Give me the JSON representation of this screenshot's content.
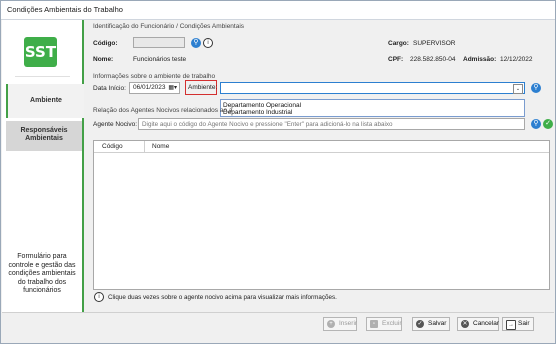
{
  "window": {
    "title": "Condições Ambientais do Trabalho"
  },
  "sidebar": {
    "logo_text": "SST",
    "items": [
      {
        "label": "Ambiente",
        "selected": true
      },
      {
        "label": "Responsáveis\nAmbientais",
        "selected": false
      }
    ],
    "description": "Formulário para controle e gestão das condições ambientais do trabalho dos funcionários"
  },
  "employee": {
    "group_title": "Identificação do Funcionário / Condições Ambientais",
    "codigo_label": "Código:",
    "codigo_value": "",
    "nome_label": "Nome:",
    "nome_value": "Funcionários teste",
    "cargo_label": "Cargo:",
    "cargo_value": "SUPERVISOR",
    "cpf_label": "CPF:",
    "cpf_value": "228.582.850-04",
    "admissao_label": "Admissão:",
    "admissao_value": "12/12/2022"
  },
  "environment": {
    "group_title": "Informações sobre o ambiente de trabalho",
    "data_inicio_label": "Data Início:",
    "data_inicio_value": "06/01/2023",
    "ambiente_label": "Ambiente:",
    "ambiente_value": "",
    "dropdown_options": [
      "Departamento Operacional",
      "Departamento Industrial"
    ]
  },
  "agents": {
    "group_title": "Relação dos Agentes Nocivos relacionados ao a",
    "agente_label": "Agente Nocivo:",
    "agente_placeholder": "Digite aqui o código do Agente Nocivo e pressione \"Enter\" para adicioná-lo na lista abaixo",
    "columns": [
      "Código",
      "Nome"
    ],
    "rows": [],
    "hint": "Clique duas vezes sobre o agente nocivo acima para visualizar mais informações."
  },
  "toolbar": {
    "inserir": "Inserir",
    "excluir": "Excluir",
    "salvar": "Salvar",
    "cancelar": "Cancelar",
    "sair": "Sair"
  },
  "colors": {
    "accent_green": "#43a047",
    "button_blue": "#2c7fd0",
    "highlight_red": "#d32f2f"
  }
}
